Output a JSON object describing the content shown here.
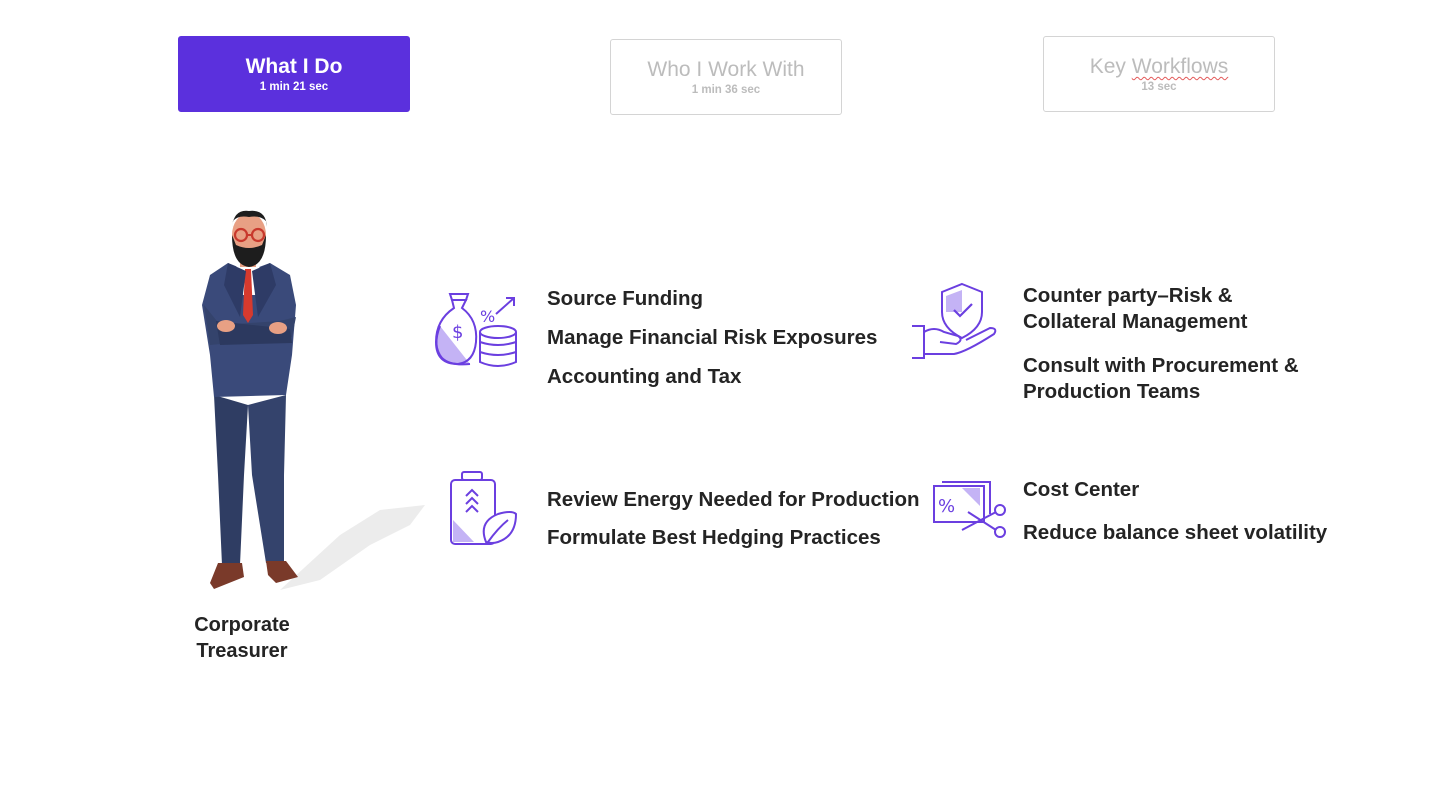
{
  "tabs": [
    {
      "title": "What I Do",
      "duration": "1 min 21 sec",
      "active": true
    },
    {
      "title": "Who I Work With",
      "duration": "1 min 36 sec",
      "active": false
    },
    {
      "title": "Key Workflows",
      "duration": "13 sec",
      "active": false
    }
  ],
  "persona": {
    "line1": "Corporate",
    "line2": "Treasurer"
  },
  "groups": {
    "funding": {
      "icon": "money-bag-coins-percent-icon",
      "items": [
        "Source Funding",
        "Manage Financial Risk Exposures",
        "Accounting and Tax"
      ]
    },
    "risk": {
      "icon": "hand-shield-check-icon",
      "items": [
        "Counter party–Risk &",
        "Collateral Management",
        "Consult with Procurement &",
        "Production Teams"
      ]
    },
    "energy": {
      "icon": "battery-leaf-icon",
      "items": [
        "Review Energy Needed for Production",
        "Formulate Best Hedging Practices"
      ]
    },
    "cost": {
      "icon": "percent-tag-scissors-icon",
      "items": [
        "Cost Center",
        "Reduce balance sheet volatility"
      ]
    }
  },
  "colors": {
    "accent": "#5b30dd",
    "icon_stroke": "#6b3fe0",
    "icon_fill": "#c4b3f5"
  }
}
